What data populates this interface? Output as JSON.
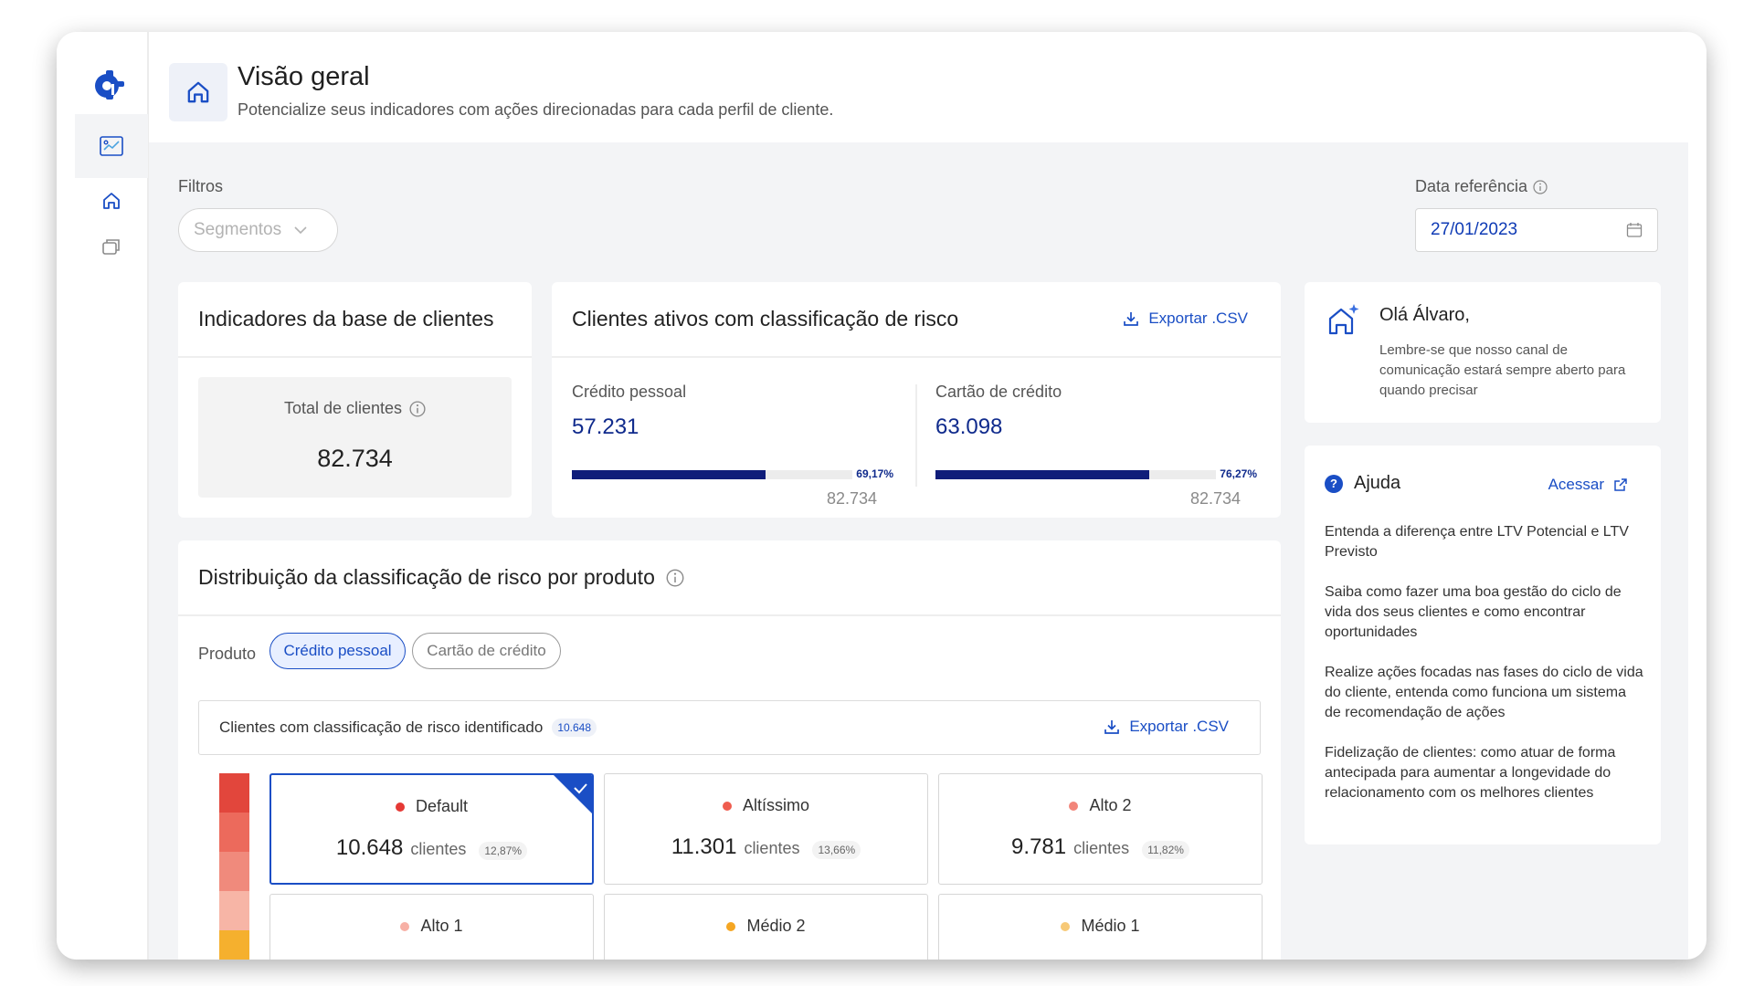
{
  "header": {
    "title": "Visão geral",
    "subtitle": "Potencialize seus indicadores com ações direcionadas para cada perfil de cliente."
  },
  "filters": {
    "label": "Filtros",
    "segments_placeholder": "Segmentos",
    "date_label": "Data referência",
    "date_value": "27/01/2023"
  },
  "indicators": {
    "title": "Indicadores da base de clientes",
    "total_label": "Total de clientes",
    "total_value": "82.734"
  },
  "risk": {
    "title": "Clientes ativos com classificação de risco",
    "export_label": "Exportar .CSV",
    "products": [
      {
        "label": "Crédito pessoal",
        "value": "57.231",
        "percent_text": "69,17%",
        "fraction": 0.6917,
        "total": "82.734"
      },
      {
        "label": "Cartão de crédito",
        "value": "63.098",
        "percent_text": "76,27%",
        "fraction": 0.7627,
        "total": "82.734"
      }
    ]
  },
  "greeting": {
    "title": "Olá Álvaro,",
    "text": "Lembre-se que nosso canal de comunicação estará sempre aberto para quando precisar"
  },
  "help": {
    "title": "Ajuda",
    "access_label": "Acessar",
    "items": [
      "Entenda a diferença entre LTV Potencial e LTV Previsto",
      "Saiba como fazer uma boa gestão do ciclo de vida dos seus clientes e como encontrar oportunidades",
      "Realize ações focadas nas fases do ciclo de vida do cliente, entenda como funciona um sistema de recomendação de ações",
      "Fidelização de clientes: como atuar de forma antecipada para aumentar a longevidade do relacionamento com os melhores clientes"
    ]
  },
  "distribution": {
    "title": "Distribuição da classificação de risco por produto",
    "product_label": "Produto",
    "tabs": [
      "Crédito pessoal",
      "Cartão de crédito"
    ],
    "identified_label": "Clientes com classificação de risco identificado",
    "identified_count": "10.648",
    "export_label": "Exportar .CSV",
    "unit": "clientes",
    "tiles": [
      {
        "name": "Default",
        "count": "10.648",
        "pct": "12,87%"
      },
      {
        "name": "Altíssimo",
        "count": "11.301",
        "pct": "13,66%"
      },
      {
        "name": "Alto 2",
        "count": "9.781",
        "pct": "11,82%"
      },
      {
        "name": "Alto 1"
      },
      {
        "name": "Médio 2"
      },
      {
        "name": "Médio 1"
      }
    ]
  },
  "colors": {
    "accent": "#1a4ec5",
    "bar_fill": "#0f1d7a",
    "risk_scale": [
      "#e2463c",
      "#ec6a5c",
      "#f08a7c",
      "#f7b5a6",
      "#f5b02e"
    ],
    "dots": [
      "#e53935",
      "#ef5d4f",
      "#f2857a",
      "#f7b0a5",
      "#f5a623",
      "#f7c977"
    ]
  }
}
